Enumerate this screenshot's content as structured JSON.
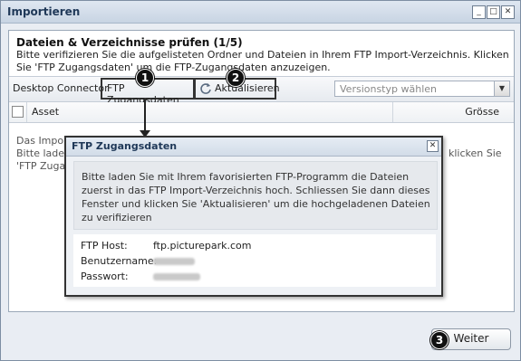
{
  "window": {
    "title": "Importieren",
    "controls": [
      "_",
      "□",
      "✕"
    ]
  },
  "header": {
    "step_title": "Dateien & Verzeichnisse prüfen (1/5)",
    "instructions": "Bitte verifizieren Sie die aufgelisteten Ordner und Dateien in Ihrem FTP Import-Verzeichnis. Klicken Sie 'FTP Zugangsdaten' um die FTP-Zugangsdaten anzuzeigen."
  },
  "toolbar": {
    "desktop_connector": "Desktop Connector",
    "ftp_button": "FTP Zugangsdaten",
    "refresh_button": "Aktualisieren",
    "refresh_icon": "refresh-icon",
    "version_select_placeholder": "Versionstyp wählen"
  },
  "grid": {
    "columns": [
      "Asset",
      "Grösse"
    ]
  },
  "background_text": {
    "line1": "Das Import",
    "line2": "Bitte laden",
    "line3": "'FTP Zugan",
    "right_fragment": "klicken Sie"
  },
  "dialog": {
    "title": "FTP Zugangsdaten",
    "message": "Bitte laden Sie mit Ihrem favorisierten FTP-Programm die Dateien zuerst in das FTP Import-Verzeichnis hoch. Schliessen Sie dann dieses Fenster und klicken Sie 'Aktualisieren' um die hochgeladenen Dateien zu verifizieren",
    "fields": [
      {
        "label": "FTP Host:",
        "value": "ftp.picturepark.com"
      },
      {
        "label": "Benutzername:",
        "value": ""
      },
      {
        "label": "Passwort:",
        "value": ""
      }
    ]
  },
  "footer": {
    "next_button": "Weiter"
  },
  "badges": [
    "1",
    "2",
    "3"
  ]
}
